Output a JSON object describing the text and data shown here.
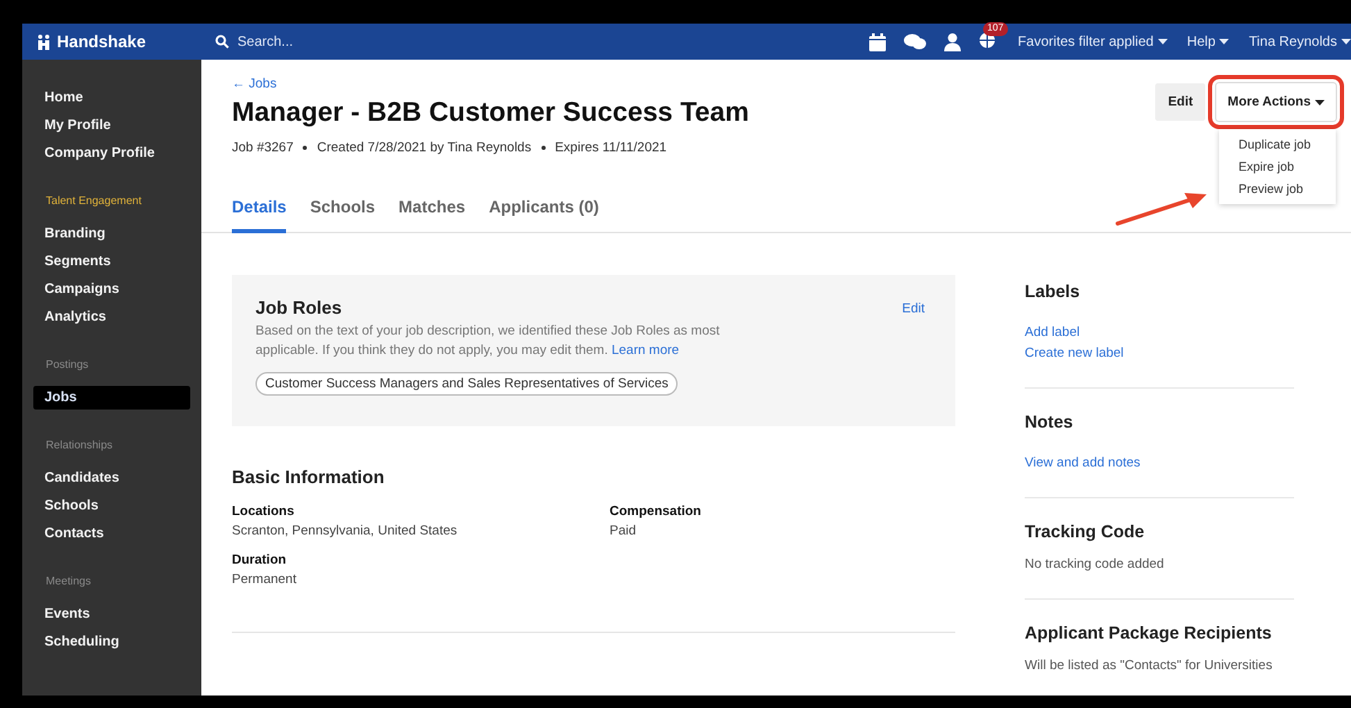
{
  "topbar": {
    "brand": "Handshake",
    "search": {
      "placeholder": "Search..."
    },
    "notification_count": "107",
    "menus": [
      "Favorites filter applied",
      "Help",
      "Tina Reynolds"
    ]
  },
  "sidebar": {
    "sections": [
      {
        "items": [
          {
            "label": "Home",
            "selected": false
          },
          {
            "label": "My Profile",
            "selected": false
          },
          {
            "label": "Company Profile",
            "selected": false
          }
        ]
      },
      {
        "heading": "Talent Engagement",
        "highlighted": true,
        "items": [
          {
            "label": "Branding",
            "selected": false
          },
          {
            "label": "Segments",
            "selected": false
          },
          {
            "label": "Campaigns",
            "selected": false
          },
          {
            "label": "Analytics",
            "selected": false
          }
        ]
      },
      {
        "heading": "Postings",
        "highlighted": false,
        "items": [
          {
            "label": "Jobs",
            "selected": true
          }
        ]
      },
      {
        "heading": "Relationships",
        "highlighted": false,
        "items": [
          {
            "label": "Candidates",
            "selected": false
          },
          {
            "label": "Schools",
            "selected": false
          },
          {
            "label": "Contacts",
            "selected": false
          }
        ]
      },
      {
        "heading": "Meetings",
        "highlighted": false,
        "items": [
          {
            "label": "Events",
            "selected": false
          },
          {
            "label": "Scheduling",
            "selected": false
          }
        ]
      }
    ]
  },
  "job": {
    "back_link": "← Jobs",
    "title": "Manager - B2B Customer Success Team",
    "meta": [
      "Job #3267",
      "Created 7/28/2021 by Tina Reynolds",
      "Expires 11/11/2021"
    ],
    "edit_button": "Edit",
    "more_actions": {
      "label": "More Actions",
      "expanded": true,
      "menu": [
        "Duplicate job",
        "Expire job",
        "Preview job"
      ]
    }
  },
  "tabs": [
    {
      "label": "Details",
      "selected": true
    },
    {
      "label": "Schools",
      "selected": false
    },
    {
      "label": "Matches",
      "selected": false
    },
    {
      "label": "Applicants (0)",
      "selected": false
    }
  ],
  "job_roles": {
    "title": "Job Roles",
    "edit": "Edit",
    "description": "Based on the text of your job description, we identified these Job Roles as most applicable. If you think they do not apply, you may edit them.",
    "link": "Learn more",
    "tag": "Customer Success Managers and Sales Representatives of Services"
  },
  "basic_information": {
    "title": "Basic Information",
    "fields": [
      {
        "label": "Locations",
        "value": "Scranton, Pennsylvania, United States"
      },
      {
        "label": "Compensation",
        "value": "Paid"
      },
      {
        "label": "Duration",
        "value": "Permanent"
      }
    ]
  },
  "side_sections": [
    {
      "kind": "links",
      "title": "Labels",
      "items": [
        "Add label",
        "Create new label"
      ]
    },
    {
      "kind": "links",
      "title": "Notes",
      "items": [
        "View and add notes"
      ]
    },
    {
      "kind": "text",
      "title": "Tracking Code",
      "items": [
        "No tracking code added"
      ]
    },
    {
      "kind": "text",
      "title": "Applicant Package Recipients",
      "items": [
        "Will be listed as \"Contacts\" for Universities"
      ]
    }
  ]
}
